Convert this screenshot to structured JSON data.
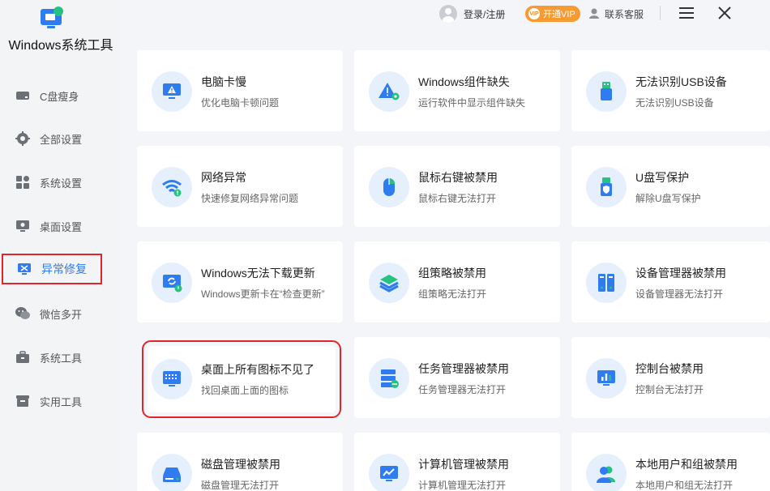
{
  "app": {
    "title": "Windows系统工具"
  },
  "topbar": {
    "login_label": "登录/注册",
    "vip_label": "开通VIP",
    "vip_badge": "VIP",
    "service_label": "联系客服"
  },
  "sidebar": {
    "items": [
      {
        "label": "C盘瘦身",
        "icon": "disk-icon"
      },
      {
        "label": "全部设置",
        "icon": "gear-icon"
      },
      {
        "label": "系统设置",
        "icon": "apps-grid-icon"
      },
      {
        "label": "桌面设置",
        "icon": "desktop-icon"
      },
      {
        "label": "异常修复",
        "icon": "repair-tools-icon",
        "active": true
      },
      {
        "label": "微信多开",
        "icon": "wechat-icon"
      },
      {
        "label": "系统工具",
        "icon": "toolbox-icon"
      },
      {
        "label": "实用工具",
        "icon": "box-icon"
      }
    ]
  },
  "cards": [
    {
      "title": "电脑卡慢",
      "sub": "优化电脑卡顿问题",
      "icon": "monitor-warning-icon"
    },
    {
      "title": "Windows组件缺失",
      "sub": "运行软件中显示组件缺失",
      "icon": "warning-gear-icon"
    },
    {
      "title": "无法识别USB设备",
      "sub": "无法识别USB设备",
      "icon": "usb-icon"
    },
    {
      "title": "网络异常",
      "sub": "快速修复网络异常问题",
      "icon": "wifi-icon"
    },
    {
      "title": "鼠标右键被禁用",
      "sub": "鼠标右键无法打开",
      "icon": "mouse-icon"
    },
    {
      "title": "U盘写保护",
      "sub": "解除U盘写保护",
      "icon": "usb-shield-icon"
    },
    {
      "title": "Windows无法下载更新",
      "sub": "Windows更新卡在“检查更新”",
      "icon": "update-icon"
    },
    {
      "title": "组策略被禁用",
      "sub": "组策略无法打开",
      "icon": "layers-icon"
    },
    {
      "title": "设备管理器被禁用",
      "sub": "设备管理器无法打开",
      "icon": "device-manager-icon"
    },
    {
      "title": "桌面上所有图标不见了",
      "sub": "找回桌面上面的图标",
      "icon": "desktop-icons-icon",
      "highlighted": true
    },
    {
      "title": "任务管理器被禁用",
      "sub": "任务管理器无法打开",
      "icon": "task-manager-icon"
    },
    {
      "title": "控制台被禁用",
      "sub": "控制台无法打开",
      "icon": "console-chart-icon"
    },
    {
      "title": "磁盘管理被禁用",
      "sub": "磁盘管理无法打开",
      "icon": "disk-manage-icon"
    },
    {
      "title": "计算机管理被禁用",
      "sub": "计算机管理无法打开",
      "icon": "computer-manage-icon"
    },
    {
      "title": "本地用户和组被禁用",
      "sub": "本地用户和组无法打开",
      "icon": "users-icon"
    }
  ],
  "colors": {
    "accent": "#2f7bf0",
    "highlight": "#e0262d",
    "vip": "#f79a32"
  }
}
